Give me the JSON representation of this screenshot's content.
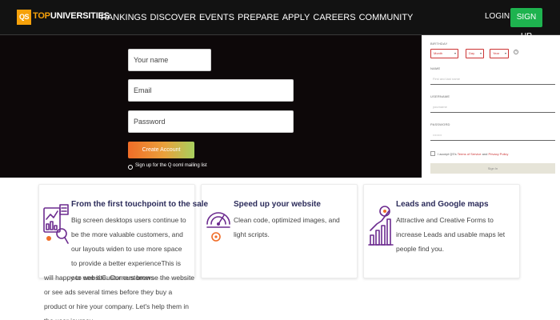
{
  "navbar": {
    "logo_badge": "QS",
    "logo_text_top": "TOP",
    "logo_text_rest": "UNIVERSITIES",
    "links": [
      "RANKINGS",
      "DISCOVER",
      "EVENTS",
      "PREPARE",
      "APPLY",
      "CAREERS",
      "COMMUNITY"
    ],
    "login": "LOGIN",
    "signup": "SIGN UP",
    "accent_color": "#f6a10a",
    "signup_color": "#1eb34f"
  },
  "signup_form": {
    "name_placeholder": "Your name",
    "email_placeholder": "Email",
    "password_placeholder": "Password",
    "submit": "Create Account",
    "mailing_list": "Sign up for the Q ooml mailing list"
  },
  "side_form": {
    "dob_label": "BIRTHDAY",
    "month": "Month",
    "day": "Day",
    "year": "Year",
    "name_label": "NAME",
    "name_placeholder": "First and last name",
    "username_label": "USERNAME",
    "username_placeholder": "yourname",
    "password_label": "PASSWORD",
    "password_placeholder": "••••••••",
    "terms_prefix": "I accept QS's",
    "terms_link": "Terms of Service",
    "terms_and": "and",
    "privacy_link": "Privacy Policy",
    "submit": "Sign In"
  },
  "cards": [
    {
      "icon": "analytics-icon",
      "title": "From the first touchpoint to the sale",
      "body": "Big screen desktops users continue to be the more valuable customers, and our layouts widen to use more space to provide a better experienceThis is our website. Our customers",
      "overflow": "will happy to see it.Customers browse the website or see ads several times before they buy a product or hire your company. Let's help them in the user journey."
    },
    {
      "icon": "speedometer-icon",
      "title": "Speed up your website",
      "body": "Clean code, optimized images, and light scripts."
    },
    {
      "icon": "growth-chart-icon",
      "title": "Leads and Google maps",
      "body": "Attractive and Creative Forms to increase Leads and usable maps let people find you."
    }
  ]
}
